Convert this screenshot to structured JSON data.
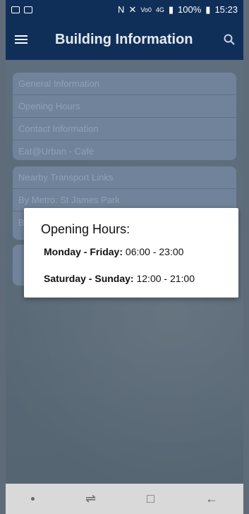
{
  "status_bar": {
    "time": "15:23",
    "battery_percent": "100%",
    "network_labels": [
      "Vo0",
      "LTE",
      "4G"
    ],
    "icons": [
      "image-icon",
      "checkbox-icon",
      "nfc-icon",
      "mute-icon",
      "signal-icon",
      "battery-icon"
    ]
  },
  "app_bar": {
    "title": "Building Information",
    "left_icon": "menu-icon",
    "right_icon": "search-icon",
    "background": "#0f2f59"
  },
  "cards": [
    {
      "items": [
        "General Information",
        "Opening Hours",
        "Contact Information",
        "Eat@Urban - Cafe"
      ]
    },
    {
      "items": [
        "Nearby Transport Links",
        "By Metro: St James Park",
        "B"
      ]
    },
    {
      "items": [
        ""
      ]
    }
  ],
  "dialog": {
    "title": "Opening Hours:",
    "lines": [
      {
        "label": "Monday - Friday:",
        "value": " 06:00 - 23:00"
      },
      {
        "label": "Saturday - Sunday:",
        "value": " 12:00 - 21:00"
      }
    ]
  },
  "nav_bar": {
    "icons": [
      "dot-icon",
      "recent-apps-icon",
      "home-icon",
      "back-icon"
    ],
    "background": "#d9d9d9"
  }
}
